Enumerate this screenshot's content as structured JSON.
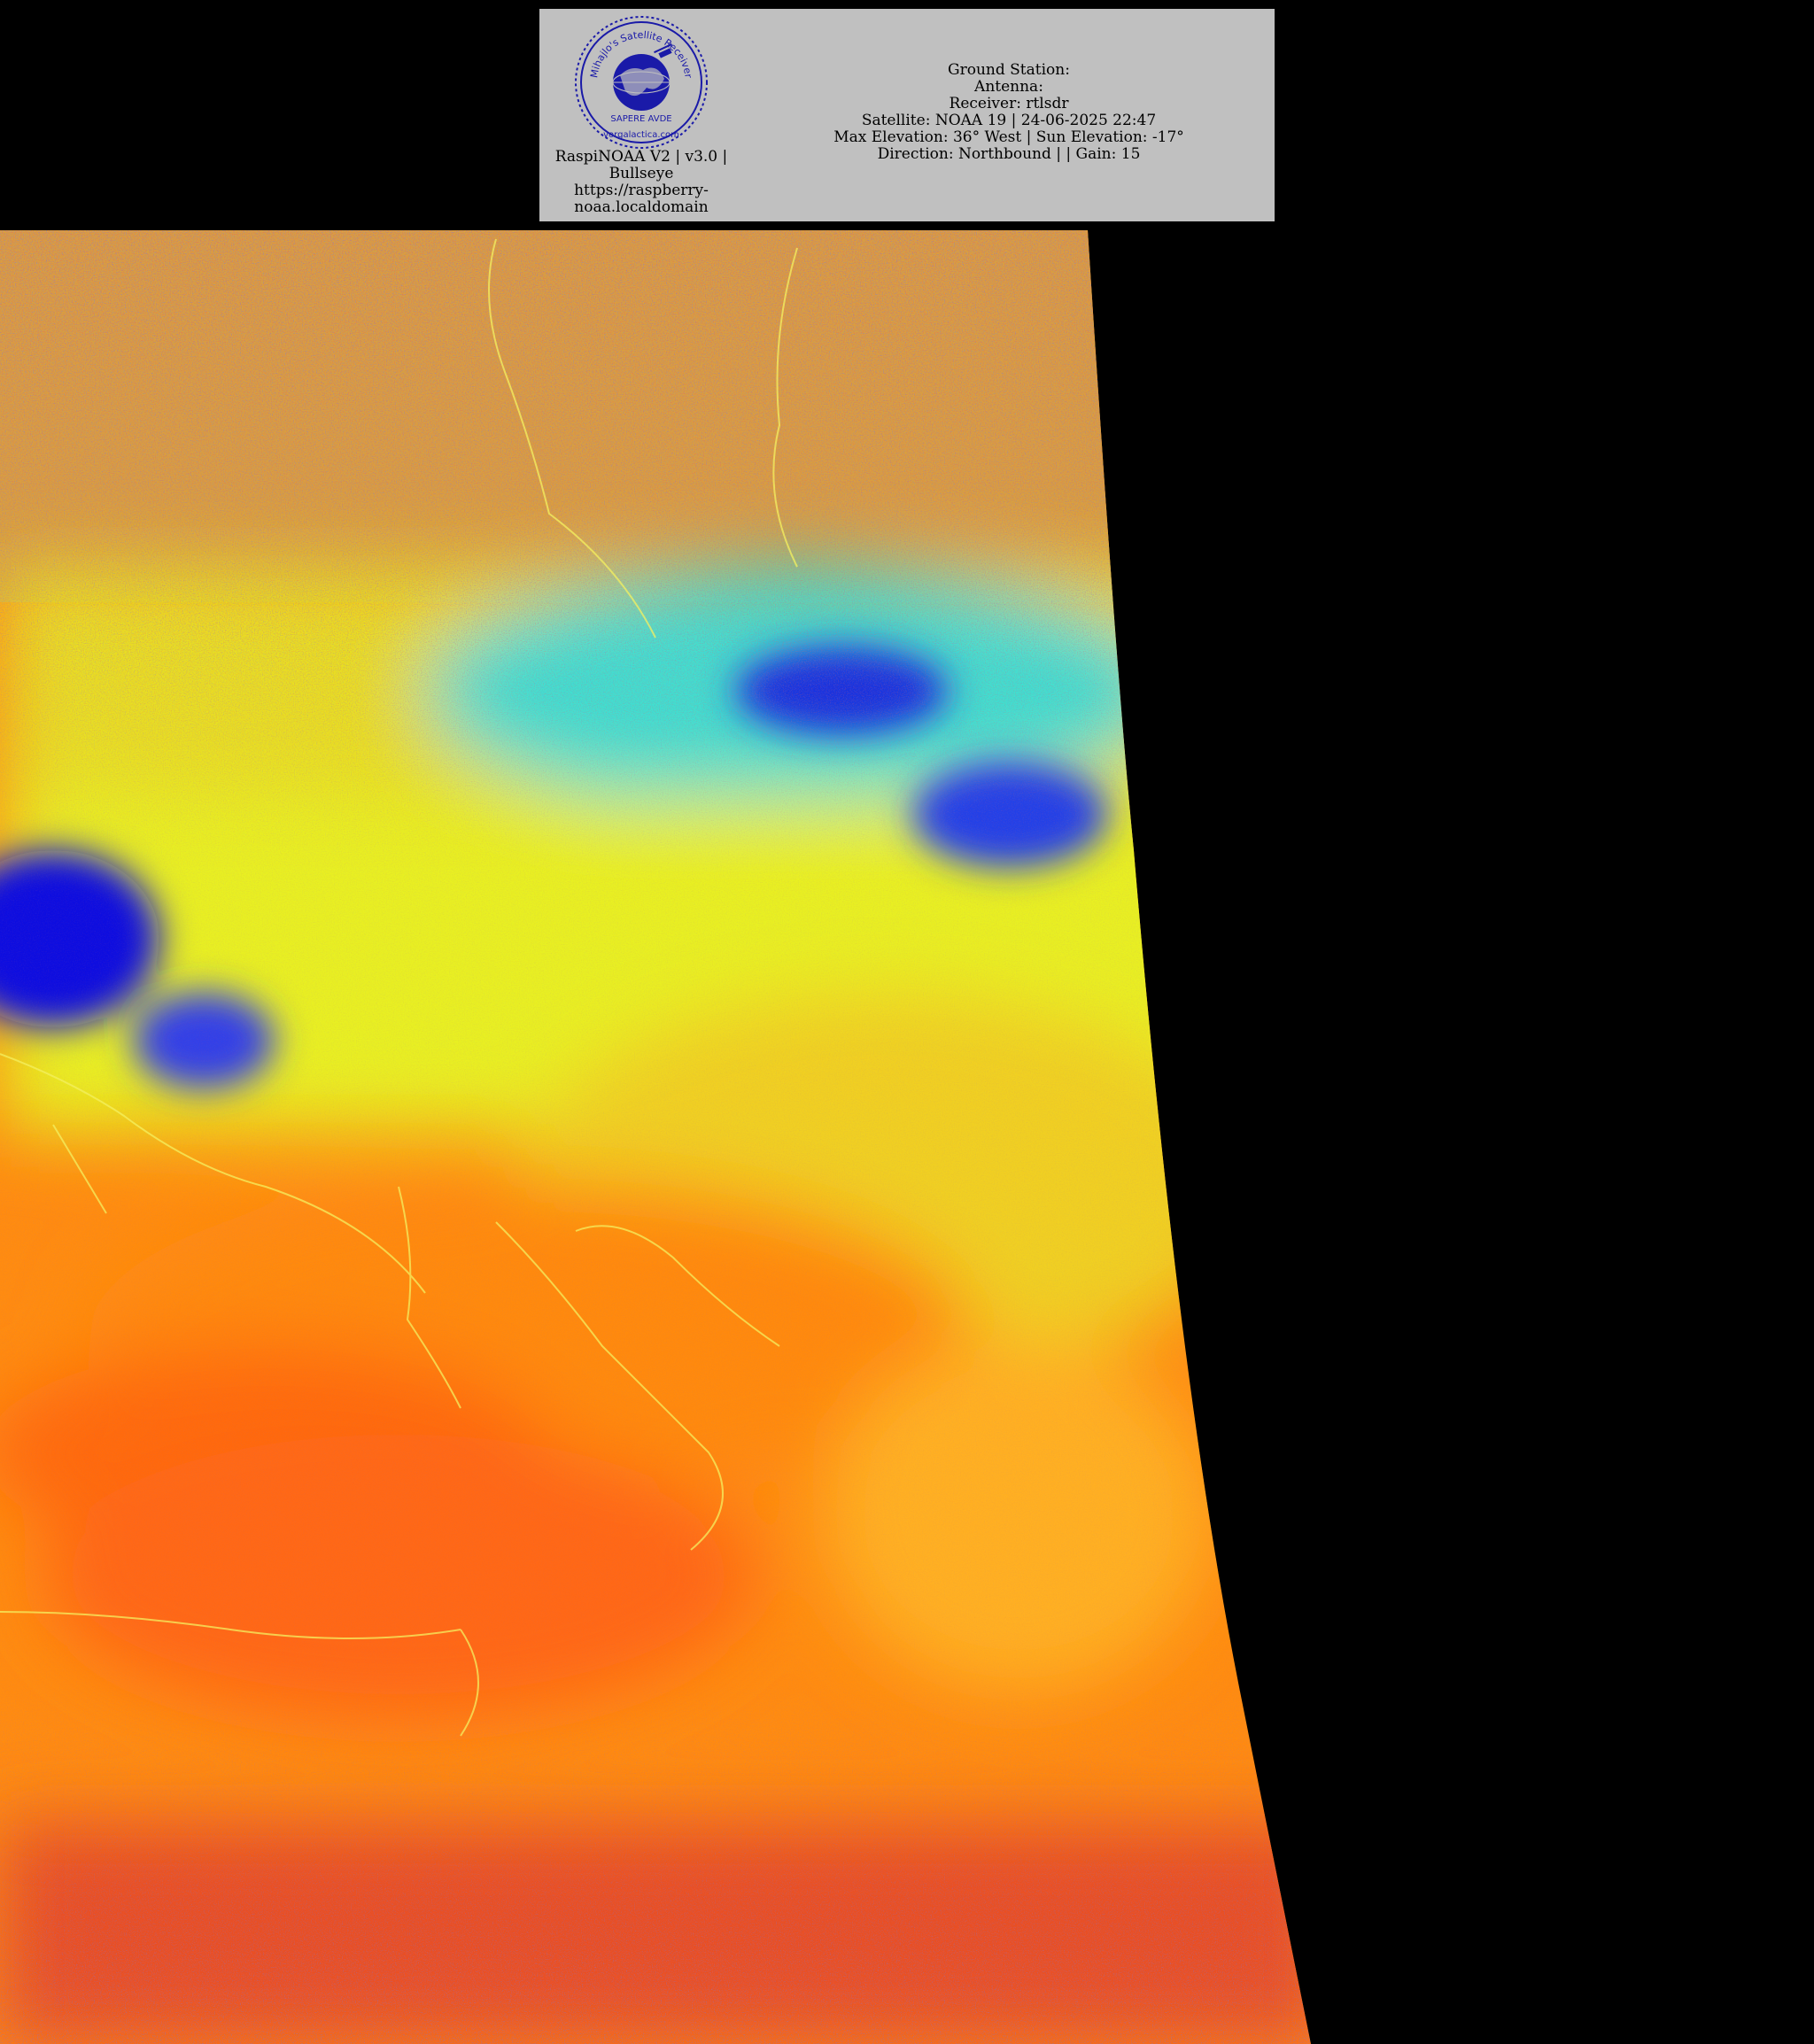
{
  "header": {
    "logo": {
      "icon": "globe-satellite-seal-icon",
      "arc_text_top": "Mihajlo's Satellite Receiver",
      "arc_text_mid": "SAPERE AVDE",
      "arc_text_bottom": "vorgalactica.com",
      "color": "#1a1aa8"
    },
    "left_caption": {
      "line1": "RaspiNOAA V2 | v3.0 |",
      "line2": "Bullseye",
      "line3": "https://raspberry-",
      "line4": "noaa.localdomain"
    },
    "info": {
      "ground_station": "Ground Station:",
      "antenna": "Antenna:",
      "receiver": "Receiver: rtlsdr",
      "satellite": "Satellite: NOAA 19 | 24-06-2025 22:47",
      "elevation": "Max Elevation: 36° West | Sun Elevation: -17°",
      "direction": "Direction: Northbound | | Gain: 15"
    }
  },
  "image": {
    "palette": {
      "cold_blue": "#1010e0",
      "cyan": "#30e0e0",
      "yellow": "#f0f020",
      "orange": "#ff9a10",
      "red_orange": "#ff6010",
      "noise_red": "#e02020",
      "background": "#000000"
    }
  }
}
